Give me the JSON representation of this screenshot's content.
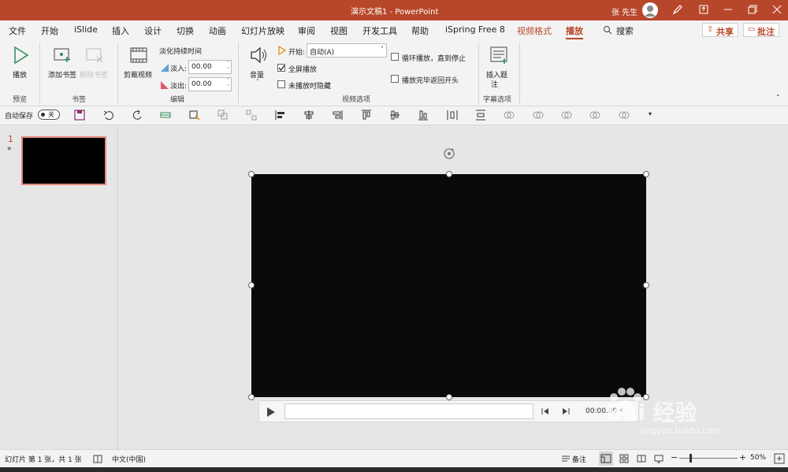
{
  "window": {
    "title": "演示文稿1  -  PowerPoint",
    "user": "张 先生",
    "accent": "#b7472a"
  },
  "tabs": [
    "文件",
    "开始",
    "iSlide",
    "插入",
    "设计",
    "切换",
    "动画",
    "幻灯片放映",
    "审阅",
    "视图",
    "开发工具",
    "帮助",
    "iSpring Free 8",
    "视频格式",
    "播放"
  ],
  "search_label": "搜索",
  "share_label": "共享",
  "comment_label": "批注",
  "ribbon": {
    "play": "播放",
    "add_bookmark": "添加书签",
    "remove_bookmark": "删除书签",
    "trim_video": "剪裁视频",
    "fade_title": "淡化持续时间",
    "fade_in_label": "淡入:",
    "fade_in_value": "00.00",
    "fade_out_label": "淡出:",
    "fade_out_value": "00.00",
    "volume": "音量",
    "start_label": "开始:",
    "start_value": "自动(A)",
    "fullscreen": "全屏播放",
    "hide_not_playing": "未播放时隐藏",
    "loop": "循环播放，直到停止",
    "rewind": "播放完毕返回开头",
    "insert_caption_1": "插入题",
    "insert_caption_2": "注",
    "groups": {
      "preview": "预览",
      "bookmarks": "书签",
      "edit": "编辑",
      "video_options": "视频选项",
      "caption_options": "字幕选项"
    }
  },
  "qat": {
    "autosave": "自动保存",
    "toggle": "关"
  },
  "slides": [
    {
      "number": "1",
      "star": "*"
    }
  ],
  "player": {
    "time": "00:00.00"
  },
  "status": {
    "slide_info": "幻灯片 第 1 张，共 1 张",
    "language": "中文(中国)",
    "notes": "备注",
    "zoom": "50%"
  },
  "watermark": {
    "text": "Bai 经验",
    "url": "jingyan.baidu.com"
  }
}
